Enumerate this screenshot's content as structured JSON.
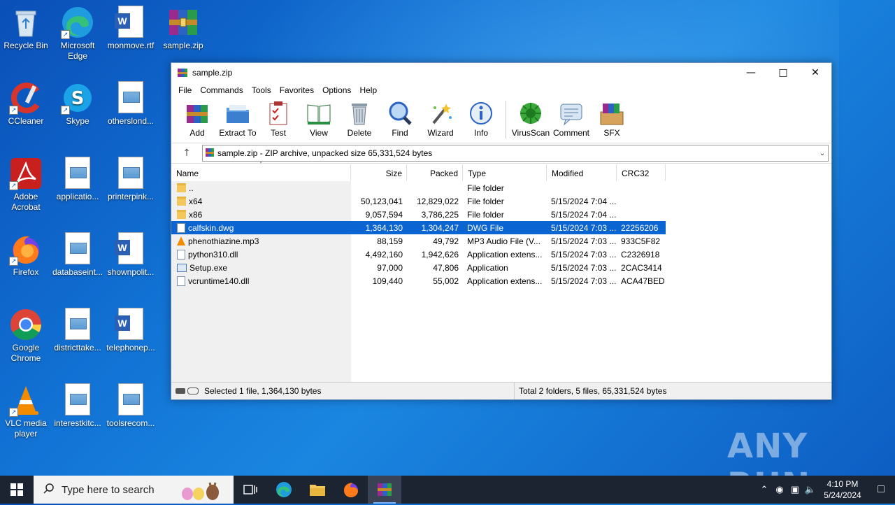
{
  "desktop": {
    "icons": [
      {
        "label": "Recycle Bin",
        "icon": "recycle-bin-icon"
      },
      {
        "label": "Microsoft Edge",
        "icon": "edge-icon"
      },
      {
        "label": "monmove.rtf",
        "icon": "word-document-icon"
      },
      {
        "label": "sample.zip",
        "icon": "winrar-archive-icon"
      },
      {
        "label": "CCleaner",
        "icon": "ccleaner-icon"
      },
      {
        "label": "Skype",
        "icon": "skype-icon"
      },
      {
        "label": "otherslond...",
        "icon": "image-file-icon"
      },
      {
        "label": "Adobe Acrobat",
        "icon": "acrobat-icon"
      },
      {
        "label": "applicatio...",
        "icon": "image-file-icon"
      },
      {
        "label": "printerpink...",
        "icon": "image-file-icon"
      },
      {
        "label": "Firefox",
        "icon": "firefox-icon"
      },
      {
        "label": "databaseint...",
        "icon": "image-file-icon"
      },
      {
        "label": "shownpolit...",
        "icon": "word-document-icon"
      },
      {
        "label": "Google Chrome",
        "icon": "chrome-icon"
      },
      {
        "label": "districttake...",
        "icon": "image-file-icon"
      },
      {
        "label": "telephonep...",
        "icon": "word-document-icon"
      },
      {
        "label": "VLC media player",
        "icon": "vlc-icon"
      },
      {
        "label": "interestkitc...",
        "icon": "image-file-icon"
      },
      {
        "label": "toolsrecom...",
        "icon": "image-file-icon"
      }
    ]
  },
  "window": {
    "title": "sample.zip",
    "menu": [
      "File",
      "Commands",
      "Tools",
      "Favorites",
      "Options",
      "Help"
    ],
    "toolbar": [
      {
        "label": "Add",
        "icon": "add-icon"
      },
      {
        "label": "Extract To",
        "icon": "extract-icon"
      },
      {
        "label": "Test",
        "icon": "test-icon"
      },
      {
        "label": "View",
        "icon": "view-icon"
      },
      {
        "label": "Delete",
        "icon": "delete-icon"
      },
      {
        "label": "Find",
        "icon": "find-icon"
      },
      {
        "label": "Wizard",
        "icon": "wizard-icon"
      },
      {
        "label": "Info",
        "icon": "info-icon"
      },
      {
        "label": "VirusScan",
        "icon": "virusscan-icon"
      },
      {
        "label": "Comment",
        "icon": "comment-icon"
      },
      {
        "label": "SFX",
        "icon": "sfx-icon"
      }
    ],
    "address": "sample.zip - ZIP archive, unpacked size 65,331,524 bytes",
    "columns": {
      "name": "Name",
      "size": "Size",
      "packed": "Packed",
      "type": "Type",
      "modified": "Modified",
      "crc": "CRC32"
    },
    "files": [
      {
        "name": "..",
        "size": "",
        "packed": "",
        "type": "File folder",
        "modified": "",
        "crc": "",
        "kind": "folder"
      },
      {
        "name": "x64",
        "size": "50,123,041",
        "packed": "12,829,022",
        "type": "File folder",
        "modified": "5/15/2024 7:04 ...",
        "crc": "",
        "kind": "folder"
      },
      {
        "name": "x86",
        "size": "9,057,594",
        "packed": "3,786,225",
        "type": "File folder",
        "modified": "5/15/2024 7:04 ...",
        "crc": "",
        "kind": "folder"
      },
      {
        "name": "calfskin.dwg",
        "size": "1,364,130",
        "packed": "1,304,247",
        "type": "DWG File",
        "modified": "5/15/2024 7:03 ...",
        "crc": "22256206",
        "kind": "file",
        "selected": true
      },
      {
        "name": "phenothiazine.mp3",
        "size": "88,159",
        "packed": "49,792",
        "type": "MP3 Audio File (V...",
        "modified": "5/15/2024 7:03 ...",
        "crc": "933C5F82",
        "kind": "mp3"
      },
      {
        "name": "python310.dll",
        "size": "4,492,160",
        "packed": "1,942,626",
        "type": "Application extens...",
        "modified": "5/15/2024 7:03 ...",
        "crc": "C2326918",
        "kind": "file"
      },
      {
        "name": "Setup.exe",
        "size": "97,000",
        "packed": "47,806",
        "type": "Application",
        "modified": "5/15/2024 7:03 ...",
        "crc": "2CAC3414",
        "kind": "exe"
      },
      {
        "name": "vcruntime140.dll",
        "size": "109,440",
        "packed": "55,002",
        "type": "Application extens...",
        "modified": "5/15/2024 7:03 ...",
        "crc": "ACA47BED",
        "kind": "file"
      }
    ],
    "status_left": "Selected 1 file, 1,364,130 bytes",
    "status_right": "Total 2 folders, 5 files, 65,331,524 bytes"
  },
  "taskbar": {
    "search_placeholder": "Type here to search",
    "time": "4:10 PM",
    "date": "5/24/2024"
  },
  "watermark": "ANY RUN"
}
